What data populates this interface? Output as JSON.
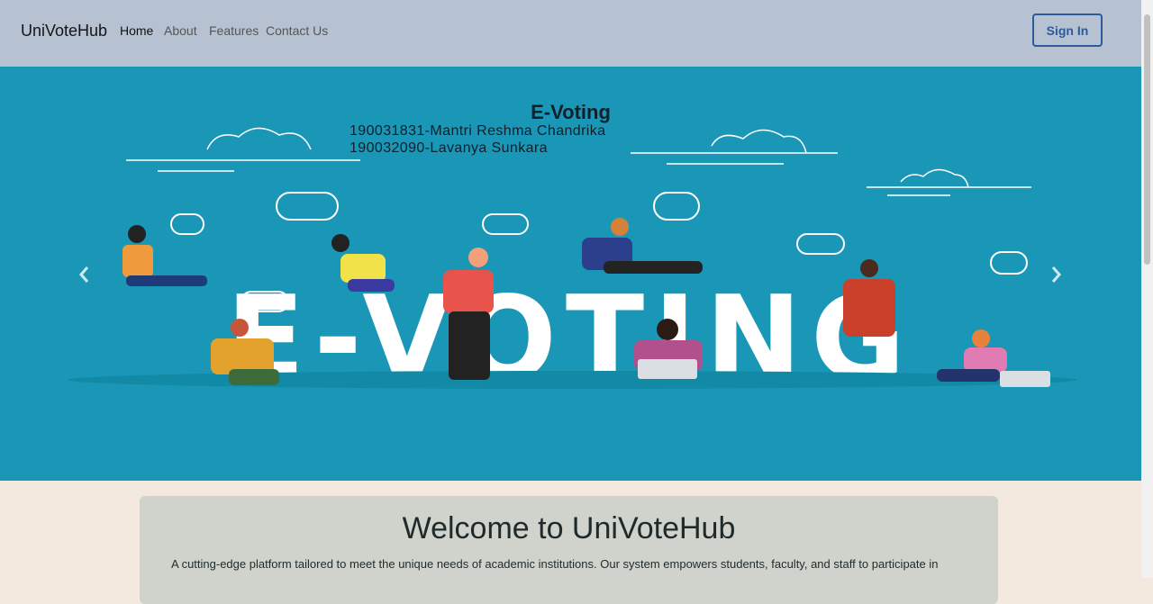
{
  "navbar": {
    "brand": "UniVoteHub",
    "links": [
      "Home",
      "About",
      "Features",
      "Contact Us"
    ],
    "sign_in_label": "Sign In"
  },
  "hero": {
    "title": "E-Voting",
    "authors": [
      "190031831-Mantri Reshma Chandrika",
      "190032090-Lavanya Sunkara"
    ],
    "banner_text": "E-VOTING",
    "prev_icon": "chevron-left-icon",
    "next_icon": "chevron-right-icon"
  },
  "welcome": {
    "title": "Welcome to UniVoteHub",
    "text": "A cutting-edge platform tailored to meet the unique needs of academic institutions. Our system empowers students, faculty, and staff to participate in"
  },
  "colors": {
    "navbar_bg": "#b6c1d1",
    "hero_bg": "#1a97b6",
    "accent": "#2c5a9a",
    "page_bg": "#f4e9df",
    "card_bg": "#cfd3cc"
  }
}
